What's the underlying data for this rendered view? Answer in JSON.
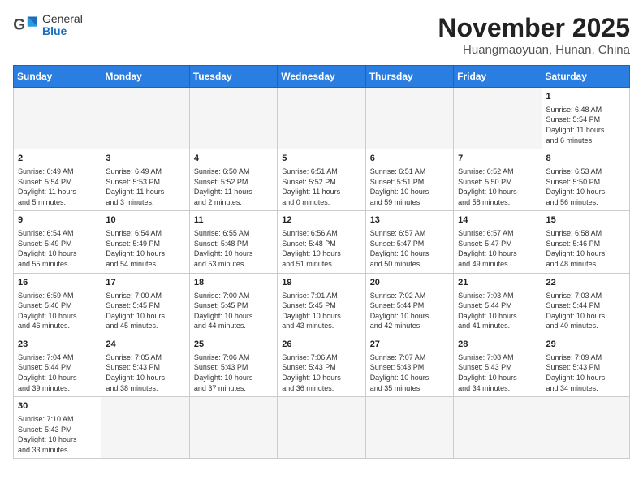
{
  "header": {
    "logo_general": "General",
    "logo_blue": "Blue",
    "month_title": "November 2025",
    "location": "Huangmaoyuan, Hunan, China"
  },
  "weekdays": [
    "Sunday",
    "Monday",
    "Tuesday",
    "Wednesday",
    "Thursday",
    "Friday",
    "Saturday"
  ],
  "weeks": [
    [
      {
        "day": "",
        "info": ""
      },
      {
        "day": "",
        "info": ""
      },
      {
        "day": "",
        "info": ""
      },
      {
        "day": "",
        "info": ""
      },
      {
        "day": "",
        "info": ""
      },
      {
        "day": "",
        "info": ""
      },
      {
        "day": "1",
        "info": "Sunrise: 6:48 AM\nSunset: 5:54 PM\nDaylight: 11 hours\nand 6 minutes."
      }
    ],
    [
      {
        "day": "2",
        "info": "Sunrise: 6:49 AM\nSunset: 5:54 PM\nDaylight: 11 hours\nand 5 minutes."
      },
      {
        "day": "3",
        "info": "Sunrise: 6:49 AM\nSunset: 5:53 PM\nDaylight: 11 hours\nand 3 minutes."
      },
      {
        "day": "4",
        "info": "Sunrise: 6:50 AM\nSunset: 5:52 PM\nDaylight: 11 hours\nand 2 minutes."
      },
      {
        "day": "5",
        "info": "Sunrise: 6:51 AM\nSunset: 5:52 PM\nDaylight: 11 hours\nand 0 minutes."
      },
      {
        "day": "6",
        "info": "Sunrise: 6:51 AM\nSunset: 5:51 PM\nDaylight: 10 hours\nand 59 minutes."
      },
      {
        "day": "7",
        "info": "Sunrise: 6:52 AM\nSunset: 5:50 PM\nDaylight: 10 hours\nand 58 minutes."
      },
      {
        "day": "8",
        "info": "Sunrise: 6:53 AM\nSunset: 5:50 PM\nDaylight: 10 hours\nand 56 minutes."
      }
    ],
    [
      {
        "day": "9",
        "info": "Sunrise: 6:54 AM\nSunset: 5:49 PM\nDaylight: 10 hours\nand 55 minutes."
      },
      {
        "day": "10",
        "info": "Sunrise: 6:54 AM\nSunset: 5:49 PM\nDaylight: 10 hours\nand 54 minutes."
      },
      {
        "day": "11",
        "info": "Sunrise: 6:55 AM\nSunset: 5:48 PM\nDaylight: 10 hours\nand 53 minutes."
      },
      {
        "day": "12",
        "info": "Sunrise: 6:56 AM\nSunset: 5:48 PM\nDaylight: 10 hours\nand 51 minutes."
      },
      {
        "day": "13",
        "info": "Sunrise: 6:57 AM\nSunset: 5:47 PM\nDaylight: 10 hours\nand 50 minutes."
      },
      {
        "day": "14",
        "info": "Sunrise: 6:57 AM\nSunset: 5:47 PM\nDaylight: 10 hours\nand 49 minutes."
      },
      {
        "day": "15",
        "info": "Sunrise: 6:58 AM\nSunset: 5:46 PM\nDaylight: 10 hours\nand 48 minutes."
      }
    ],
    [
      {
        "day": "16",
        "info": "Sunrise: 6:59 AM\nSunset: 5:46 PM\nDaylight: 10 hours\nand 46 minutes."
      },
      {
        "day": "17",
        "info": "Sunrise: 7:00 AM\nSunset: 5:45 PM\nDaylight: 10 hours\nand 45 minutes."
      },
      {
        "day": "18",
        "info": "Sunrise: 7:00 AM\nSunset: 5:45 PM\nDaylight: 10 hours\nand 44 minutes."
      },
      {
        "day": "19",
        "info": "Sunrise: 7:01 AM\nSunset: 5:45 PM\nDaylight: 10 hours\nand 43 minutes."
      },
      {
        "day": "20",
        "info": "Sunrise: 7:02 AM\nSunset: 5:44 PM\nDaylight: 10 hours\nand 42 minutes."
      },
      {
        "day": "21",
        "info": "Sunrise: 7:03 AM\nSunset: 5:44 PM\nDaylight: 10 hours\nand 41 minutes."
      },
      {
        "day": "22",
        "info": "Sunrise: 7:03 AM\nSunset: 5:44 PM\nDaylight: 10 hours\nand 40 minutes."
      }
    ],
    [
      {
        "day": "23",
        "info": "Sunrise: 7:04 AM\nSunset: 5:44 PM\nDaylight: 10 hours\nand 39 minutes."
      },
      {
        "day": "24",
        "info": "Sunrise: 7:05 AM\nSunset: 5:43 PM\nDaylight: 10 hours\nand 38 minutes."
      },
      {
        "day": "25",
        "info": "Sunrise: 7:06 AM\nSunset: 5:43 PM\nDaylight: 10 hours\nand 37 minutes."
      },
      {
        "day": "26",
        "info": "Sunrise: 7:06 AM\nSunset: 5:43 PM\nDaylight: 10 hours\nand 36 minutes."
      },
      {
        "day": "27",
        "info": "Sunrise: 7:07 AM\nSunset: 5:43 PM\nDaylight: 10 hours\nand 35 minutes."
      },
      {
        "day": "28",
        "info": "Sunrise: 7:08 AM\nSunset: 5:43 PM\nDaylight: 10 hours\nand 34 minutes."
      },
      {
        "day": "29",
        "info": "Sunrise: 7:09 AM\nSunset: 5:43 PM\nDaylight: 10 hours\nand 34 minutes."
      }
    ],
    [
      {
        "day": "30",
        "info": "Sunrise: 7:10 AM\nSunset: 5:43 PM\nDaylight: 10 hours\nand 33 minutes."
      },
      {
        "day": "",
        "info": ""
      },
      {
        "day": "",
        "info": ""
      },
      {
        "day": "",
        "info": ""
      },
      {
        "day": "",
        "info": ""
      },
      {
        "day": "",
        "info": ""
      },
      {
        "day": "",
        "info": ""
      }
    ]
  ]
}
